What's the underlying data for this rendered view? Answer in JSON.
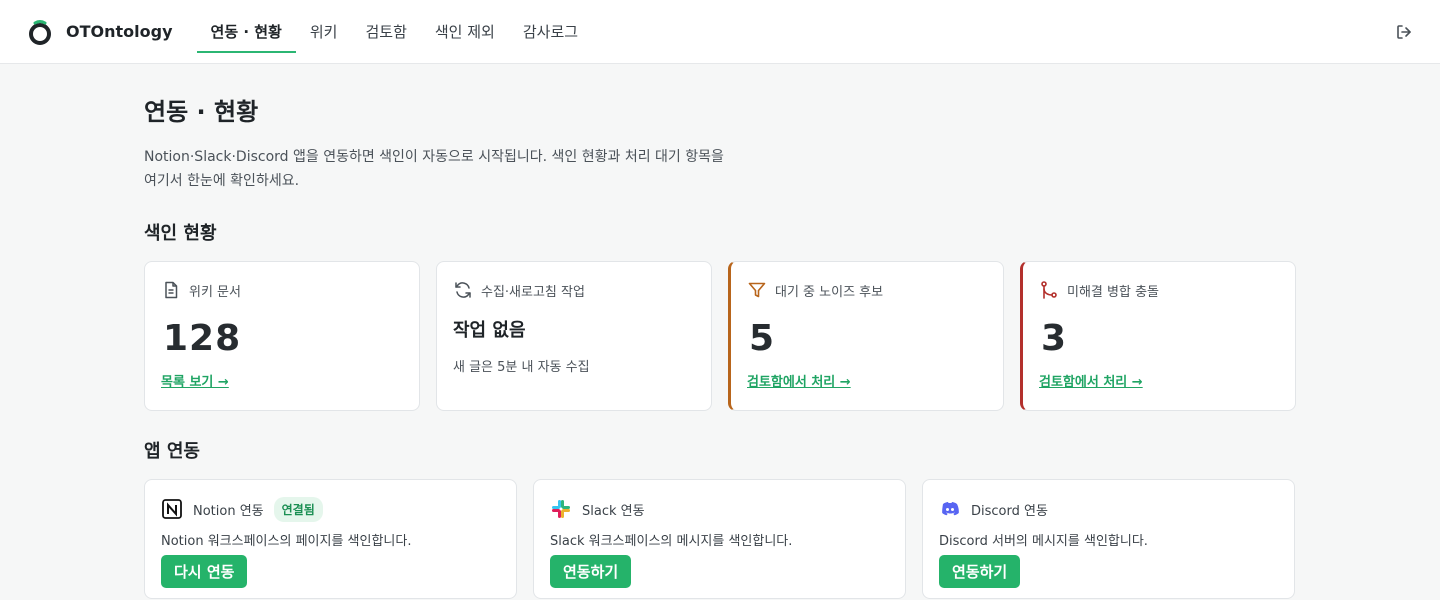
{
  "brand": {
    "name": "OTOntology"
  },
  "nav": {
    "items": [
      {
        "label": "연동 · 현황",
        "active": true
      },
      {
        "label": "위키",
        "active": false
      },
      {
        "label": "검토함",
        "active": false
      },
      {
        "label": "색인 제외",
        "active": false
      },
      {
        "label": "감사로그",
        "active": false
      }
    ],
    "logout_icon": "logout-icon"
  },
  "page": {
    "title": "연동 · 현황",
    "desc_line1": "Notion·Slack·Discord 앱을 연동하면 색인이 자동으로 시작됩니다. 색인 현황과 처리 대기 항목을",
    "desc_line2": "여기서 한눈에 확인하세요."
  },
  "index_status": {
    "title": "색인 현황",
    "cards": [
      {
        "icon": "document-icon",
        "label": "위키 문서",
        "value": "128",
        "link": "목록 보기 →"
      },
      {
        "icon": "refresh-icon",
        "label": "수집·새로고침 작업",
        "value": "작업 없음",
        "sub": "새 글은 5분 내 자동 수집"
      },
      {
        "icon": "filter-icon",
        "label": "대기 중 노이즈 후보",
        "value": "5",
        "link": "검토함에서 처리 →",
        "accent": "#b8651b"
      },
      {
        "icon": "merge-icon",
        "label": "미해결 병합 충돌",
        "value": "3",
        "link": "검토함에서 처리 →",
        "accent": "#b3302c"
      }
    ]
  },
  "apps": {
    "title": "앱 연동",
    "items": [
      {
        "icon": "notion-icon",
        "name": "Notion 연동",
        "badge": "연결됨",
        "desc": "Notion 워크스페이스의 페이지를 색인합니다.",
        "button": "다시 연동"
      },
      {
        "icon": "slack-icon",
        "name": "Slack 연동",
        "desc": "Slack 워크스페이스의 메시지를 색인합니다.",
        "button": "연동하기"
      },
      {
        "icon": "discord-icon",
        "name": "Discord 연동",
        "desc": "Discord 서버의 메시지를 색인합니다.",
        "button": "연동하기"
      }
    ]
  },
  "colors": {
    "accent": "#25b36a",
    "link": "#1fa463",
    "warn": "#b8651b",
    "danger": "#b3302c"
  }
}
